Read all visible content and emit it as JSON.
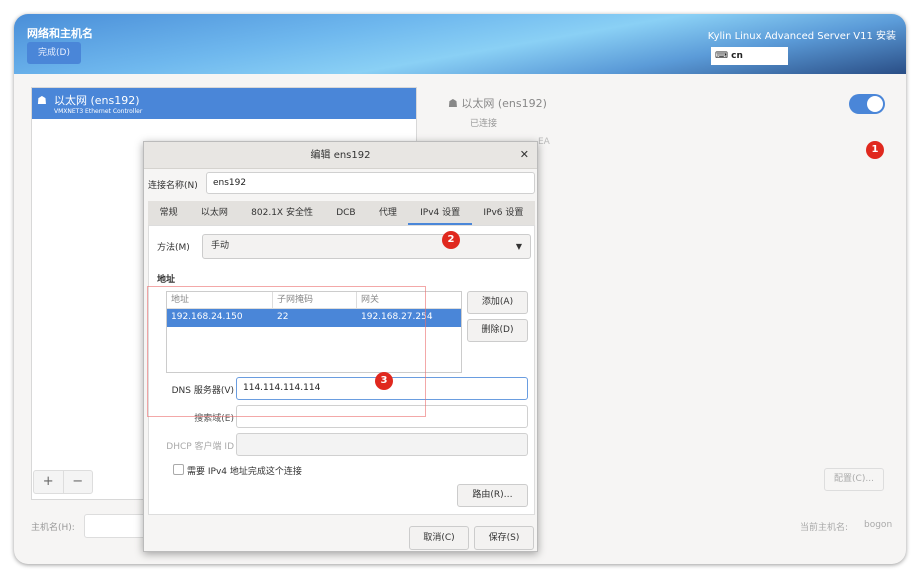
{
  "header": {
    "title": "网络和主机名",
    "done_label": "完成(D)",
    "product": "Kylin Linux Advanced Server V11 安装",
    "keyboard": "cn"
  },
  "devices": [
    {
      "name": "以太网 (ens192)",
      "desc": "VMXNET3 Ethernet Controller"
    }
  ],
  "detail": {
    "name": "以太网 (ens192)",
    "status": "已连接",
    "hw_partial": "EA",
    "enabled": true,
    "configure_label": "配置(C)..."
  },
  "hostname": {
    "label": "主机名(H):",
    "value": "",
    "current_label": "当前主机名:",
    "current_value": "bogon"
  },
  "list_buttons": {
    "add": "+",
    "remove": "−"
  },
  "badges": [
    "1",
    "2",
    "3"
  ],
  "dialog": {
    "title": "编辑 ens192",
    "conn_name_label": "连接名称(N)",
    "conn_name": "ens192",
    "tabs": [
      "常规",
      "以太网",
      "802.1X 安全性",
      "DCB",
      "代理",
      "IPv4 设置",
      "IPv6 设置"
    ],
    "active_tab": "IPv4 设置",
    "method_label": "方法(M)",
    "method": "手动",
    "address_section": "地址",
    "columns": [
      "地址",
      "子网掩码",
      "网关"
    ],
    "rows": [
      [
        "192.168.24.150",
        "22",
        "192.168.27.254"
      ]
    ],
    "add_label": "添加(A)",
    "delete_label": "删除(D)",
    "dns_label": "DNS 服务器(V)",
    "dns": "114.114.114.114",
    "search_label": "搜索域(E)",
    "search": "",
    "dhcp_label": "DHCP 客户端 ID",
    "dhcp": "",
    "require_label": "需要 IPv4 地址完成这个连接",
    "require_checked": false,
    "routes_label": "路由(R)…",
    "cancel_label": "取消(C)",
    "save_label": "保存(S)"
  },
  "colors": {
    "accent": "#4a86d8",
    "badge": "#e0281e"
  }
}
